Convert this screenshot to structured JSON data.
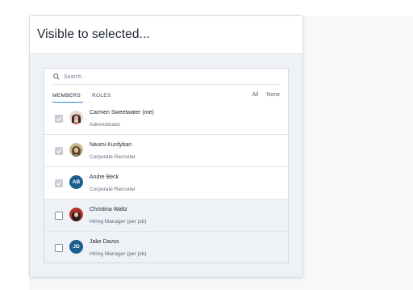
{
  "modal": {
    "title": "Visible to selected..."
  },
  "search": {
    "placeholder": "Search"
  },
  "tabs": [
    {
      "label": "MEMBERS",
      "active": true
    },
    {
      "label": "ROLES",
      "active": false
    }
  ],
  "select_links": {
    "all": "All",
    "none": "None"
  },
  "members": [
    {
      "name": "Carmen Sweetwater (me)",
      "role": "Administrator",
      "checked": true,
      "avatar": "photo"
    },
    {
      "name": "Naomi Kurdyban",
      "role": "Corporate Recruiter",
      "checked": true,
      "avatar": "photo"
    },
    {
      "name": "Andre Beck",
      "role": "Corporate Recruiter",
      "checked": true,
      "avatar": "initials",
      "initials": "AB"
    },
    {
      "name": "Christina Waltz",
      "role": "Hiring Manager (per job)",
      "checked": false,
      "avatar": "photo"
    },
    {
      "name": "Jake Davos",
      "role": "Hiring Manager (per job)",
      "checked": false,
      "avatar": "initials",
      "initials": "JD"
    }
  ],
  "colors": {
    "accent": "#2d8ae0",
    "avatar_initials_bg": "#1b5f8c",
    "unselected_row_bg": "#eef1f6"
  }
}
